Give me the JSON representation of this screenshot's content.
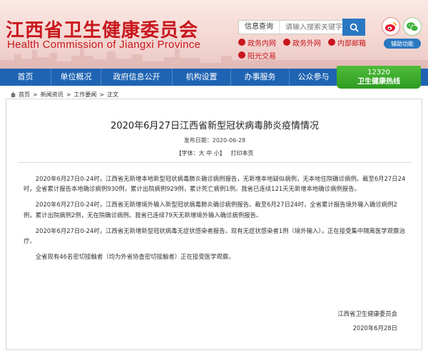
{
  "header": {
    "title": "江西省卫生健康委员会",
    "subtitle": "Health Commission of Jiangxi Province",
    "search": {
      "category": "信息查询",
      "placeholder": "请输入搜索关键字"
    },
    "quick_links": [
      "政务内网",
      "政务外网",
      "内部邮箱",
      "阳光交易"
    ],
    "accessibility_label": "辅助功能"
  },
  "nav": {
    "items": [
      "首页",
      "单位概况",
      "政府信息公开",
      "机构设置",
      "办事服务",
      "公众参与"
    ],
    "special": {
      "line1": "12320",
      "line2": "卫生健康热线"
    }
  },
  "breadcrumb": [
    "首页",
    "新闻资讯",
    "工作要闻",
    "正文"
  ],
  "article": {
    "title": "2020年6月27日江西省新型冠状病毒肺炎疫情情况",
    "date": "发布日期：2020-06-28",
    "tools": {
      "font_prefix": "【字体：",
      "large": "大",
      "medium": "中",
      "small": "小",
      "font_suffix": "】",
      "print": "打印本页"
    },
    "paragraphs": [
      "2020年6月27日0-24时，江西省无新增本地新型冠状病毒肺炎确诊病例报告，无新增本地疑似病例，无本地住院确诊病例。截至6月27日24时，全省累计报告本地确诊病例930例，累计出院病例929例，累计死亡病例1例。我省已连续121天无新增本地确诊病例报告。",
      "2020年6月27日0-24时，江西省无新增境外输入新型冠状病毒肺炎确诊病例报告。截至6月27日24时，全省累计报告境外输入确诊病例2例，累计出院病例2例，无在院确诊病例。我省已连续79天无新增境外输入确诊病例报告。",
      "2020年6月27日0-24时，江西省无新增新型冠状病毒无症状感染者报告。现有无症状感染者1例（境外输入），正在接受集中隔离医学观察治疗。",
      "全省现有46名密切接触者（均为外省协查密切接触者）正在接受医学观察。"
    ],
    "signature": {
      "org": "江西省卫生健康委员会",
      "date": "2020年6月28日"
    }
  },
  "colors": {
    "brand_red": "#c8161d",
    "nav_blue": "#1f64b3",
    "hotline_green": "#3aa82c"
  },
  "icons": [
    "search-icon",
    "weibo-icon",
    "wechat-icon",
    "home-icon"
  ]
}
